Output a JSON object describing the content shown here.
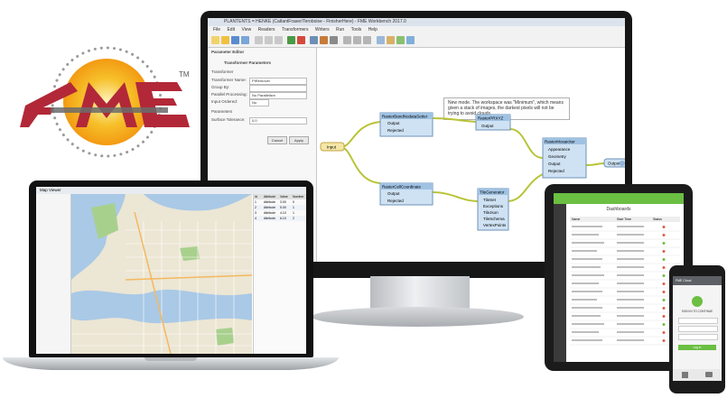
{
  "logo": {
    "text": "FME",
    "trademark": "TM",
    "colors": {
      "red": "#b22838",
      "gray": "#6b6b6b",
      "sun": "#f6b21a"
    }
  },
  "monitor": {
    "window_title": "PLANTENTS = HENKE (CatlantFraser/Teroboise - FinisherHere) - FME Workbench 2017.0",
    "menu": [
      "File",
      "Edit",
      "View",
      "Readers",
      "Transformers",
      "Writers",
      "Run",
      "Tools",
      "Help"
    ],
    "panel_title": "Parameter Editor",
    "panel_subtitle": "Transformer Parameters",
    "panel_section": "Transformer",
    "fields": [
      {
        "label": "Transformer Name:",
        "value": "PIRemover"
      },
      {
        "label": "Group By:",
        "value": ""
      },
      {
        "label": "Parallel Processing:",
        "value": "No Parallelism"
      },
      {
        "label": "Input Ordered:",
        "value": "No"
      }
    ],
    "params_label": "Parameters",
    "param_field": {
      "label": "Surface Tolerance:",
      "value": "0.0"
    },
    "buttons": {
      "cancel": "Cancel",
      "apply": "Apply"
    },
    "tooltip": "New mode. The workspace was \"Minimum\", which means given a stack of images, the darkest pixels will not be trying to avoid clouds.",
    "nodes": {
      "input": "Input",
      "t1": "RasterBandNodataSetter",
      "t1_ports": [
        "Output",
        "Rejected"
      ],
      "t2": "RasterPRXYZ",
      "t2_ports": [
        "Output"
      ],
      "t3": "RasterMosaicker",
      "t3_ports": [
        "Appearance",
        "Geometry",
        "Output",
        "Rejected"
      ],
      "t4": "RasterCellCoordinate",
      "t4_ports": [
        "Output",
        "Rejected"
      ],
      "t5": "TileGenerator",
      "t5_ports": [
        "TileSet",
        "Exceptions",
        "TileJson",
        "TileSchema",
        "VertexPoints"
      ],
      "output": "Output"
    }
  },
  "laptop": {
    "title": "Map Viewer",
    "table_headers": [
      "Id",
      "Attribute",
      "Value",
      "Number"
    ],
    "rows": [
      [
        "1",
        "Attribute",
        "3.00",
        "0"
      ],
      [
        "2",
        "Attribute",
        "5.00",
        "1"
      ],
      [
        "3",
        "Attribute",
        "4.10",
        "1"
      ],
      [
        "4",
        "Attribute",
        "6.10",
        "2"
      ]
    ]
  },
  "tablet": {
    "title": "Dashboards",
    "columns": [
      "Name",
      "Start Time",
      "Status"
    ],
    "rows": 16
  },
  "phone": {
    "header": "FME Cloud",
    "title": "SIGN IN TO CONTINUE",
    "button": "Log In"
  }
}
